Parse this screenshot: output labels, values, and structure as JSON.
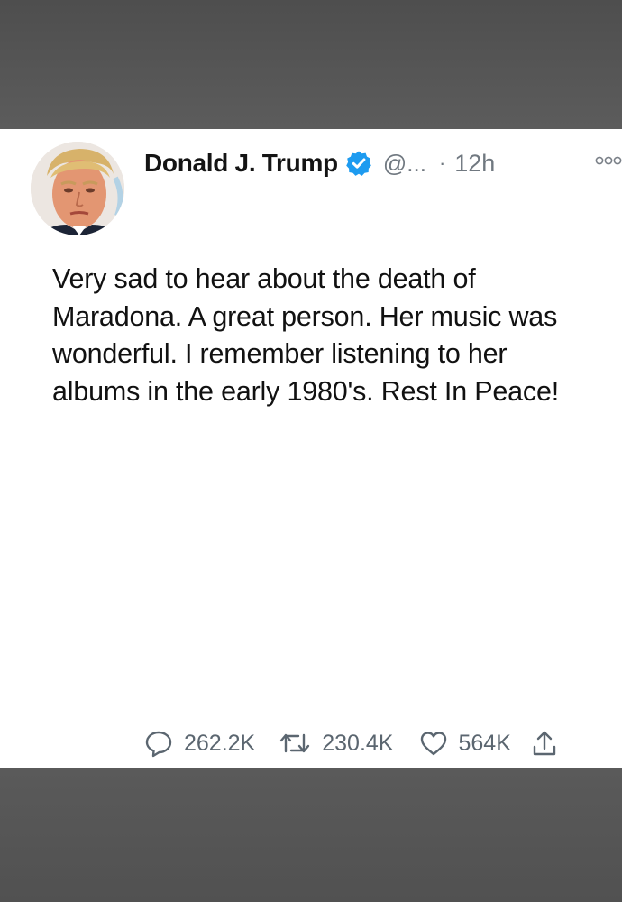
{
  "tweet": {
    "author_name": "Donald J. Trump",
    "handle": "@...",
    "separator": "·",
    "time": "12h",
    "text": "Very sad to hear about the death of Maradona. A great person. Her music was wonderful. I remember listening to her albums in the early 1980's. Rest In Peace!",
    "verified": true
  },
  "actions": {
    "replies": "262.2K",
    "retweets": "230.4K",
    "likes": "564K"
  },
  "icons": {
    "avatar": "profile-photo",
    "verified": "verified-badge-icon",
    "more": "more-options-icon",
    "reply": "reply-bubble-icon",
    "retweet": "retweet-icon",
    "like": "heart-icon",
    "share": "share-icon"
  },
  "colors": {
    "verified_blue": "#1d9bf0",
    "muted_text": "#707880",
    "background_band": "#595959"
  }
}
